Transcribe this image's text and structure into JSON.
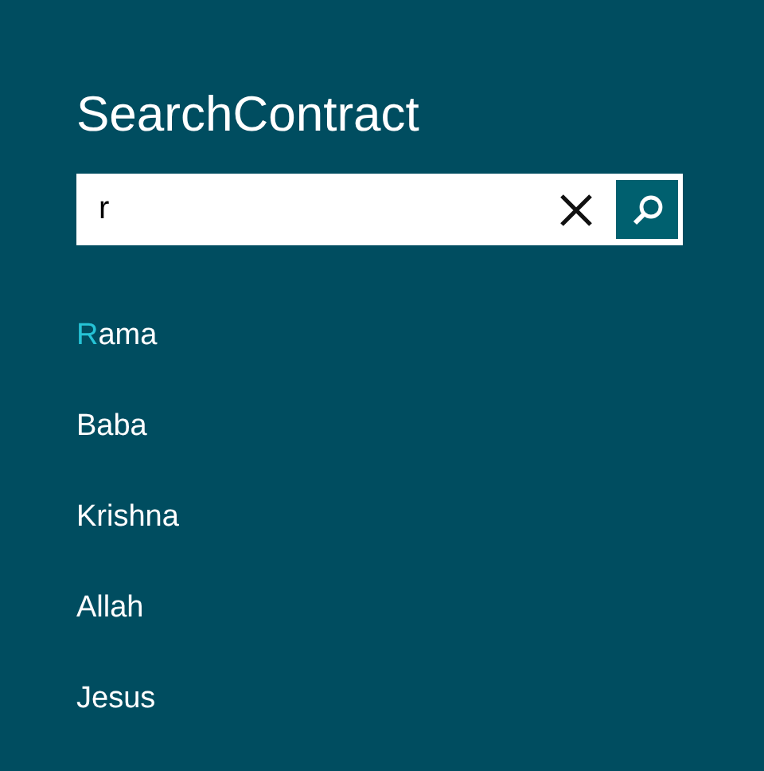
{
  "title": "SearchContract",
  "search": {
    "value": "r"
  },
  "results": [
    {
      "parts": [
        {
          "text": "R",
          "highlighted": true
        },
        {
          "text": "ama",
          "highlighted": false
        }
      ]
    },
    {
      "parts": [
        {
          "text": "Baba",
          "highlighted": false
        }
      ]
    },
    {
      "parts": [
        {
          "text": "Krishna",
          "highlighted": false
        }
      ]
    },
    {
      "parts": [
        {
          "text": "Allah",
          "highlighted": false
        }
      ]
    },
    {
      "parts": [
        {
          "text": "Jesus",
          "highlighted": false
        }
      ]
    }
  ]
}
